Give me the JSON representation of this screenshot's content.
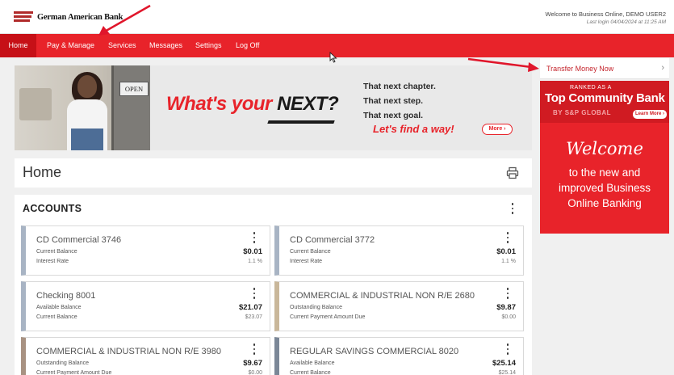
{
  "brand": {
    "name": "German American Bank"
  },
  "header": {
    "welcome": "Welcome to Business Online, DEMO USER2",
    "last_login": "Last login 04/04/2024 at 11:25 AM"
  },
  "nav": {
    "items": [
      {
        "label": "Home"
      },
      {
        "label": "Pay & Manage"
      },
      {
        "label": "Services"
      },
      {
        "label": "Messages"
      },
      {
        "label": "Settings"
      },
      {
        "label": "Log Off"
      }
    ],
    "active": "Home"
  },
  "banner": {
    "sign": "OPEN",
    "headline_a": "What's your ",
    "headline_b": "NEXT?",
    "tagline": [
      "That next chapter.",
      "That next step.",
      "That next goal."
    ],
    "cta_text": "Let's find a way!",
    "more_label": "More ›"
  },
  "page": {
    "title": "Home"
  },
  "accounts": {
    "title": "ACCOUNTS",
    "tiles": [
      {
        "name": "CD Commercial 3746",
        "label1": "Current Balance",
        "value1": "$0.01",
        "label2": "Interest Rate",
        "value2": "1.1 %",
        "accent": "#a8b4c4"
      },
      {
        "name": "CD Commercial 3772",
        "label1": "Current Balance",
        "value1": "$0.01",
        "label2": "Interest Rate",
        "value2": "1.1 %",
        "accent": "#a8b4c4"
      },
      {
        "name": "Checking 8001",
        "label1": "Available Balance",
        "value1": "$21.07",
        "label2": "Current Balance",
        "value2": "$23.07",
        "accent": "#a8b4c4"
      },
      {
        "name": "COMMERCIAL & INDUSTRIAL NON R/E 2680",
        "label1": "Outstanding Balance",
        "value1": "$9.87",
        "label2": "Current Payment Amount Due",
        "value2": "$0.00",
        "accent": "#c9b79a"
      },
      {
        "name": "COMMERCIAL & INDUSTRIAL NON R/E 3980",
        "label1": "Outstanding Balance",
        "value1": "$9.67",
        "label2": "Current Payment Amount Due",
        "value2": "$0.00",
        "accent": "#a89282"
      },
      {
        "name": "REGULAR SAVINGS COMMERCIAL 8020",
        "label1": "Available Balance",
        "value1": "$25.14",
        "label2": "Current Balance",
        "value2": "$25.14",
        "accent": "#7b8797"
      }
    ]
  },
  "sidebar": {
    "transfer_label": "Transfer Money Now",
    "ad": {
      "ranked": "RANKED AS A",
      "headline": "Top Community Bank",
      "source": "BY S&P GLOBAL",
      "learn_more": "Learn More ›",
      "welcome": "Welcome",
      "subtext": [
        "to the new and",
        "improved Business",
        "Online Banking"
      ]
    }
  },
  "colors": {
    "brand_red": "#e8232a",
    "nav_active": "#c61017",
    "annotation_red": "#e0162b"
  }
}
